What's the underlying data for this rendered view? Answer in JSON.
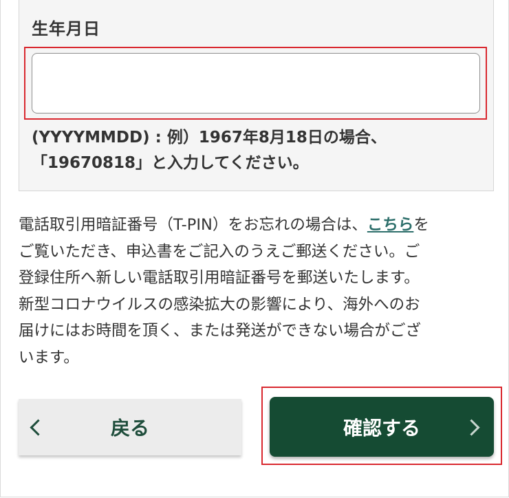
{
  "dob": {
    "label": "生年月日",
    "value": "",
    "help_line1": "(YYYYMMDD) : 例）1967年8月18日の場合、",
    "help_line2": "「19670818」と入力してください。"
  },
  "notice": {
    "line1_before": "電話取引用暗証番号（T-PIN）をお忘れの場合は、",
    "line1_link": "こちら",
    "line1_after": "を",
    "line2": "ご覧いただき、申込書をご記入のうえご郵送ください。ご",
    "line3": "登録住所へ新しい電話取引用暗証番号を郵送いたします。",
    "line4": "新型コロナウイルスの感染拡大の影響により、海外へのお",
    "line5": "届けにはお時間を頂く、または発送ができない場合がござ",
    "line6": "います。"
  },
  "buttons": {
    "back_label": "戻る",
    "confirm_label": "確認する"
  },
  "colors": {
    "primary": "#154b33",
    "link": "#2c6e6a",
    "highlight": "#d9272e",
    "panel": "#f5f5f5"
  },
  "icons": {
    "back": "chevron-left-icon",
    "confirm": "chevron-right-icon"
  }
}
